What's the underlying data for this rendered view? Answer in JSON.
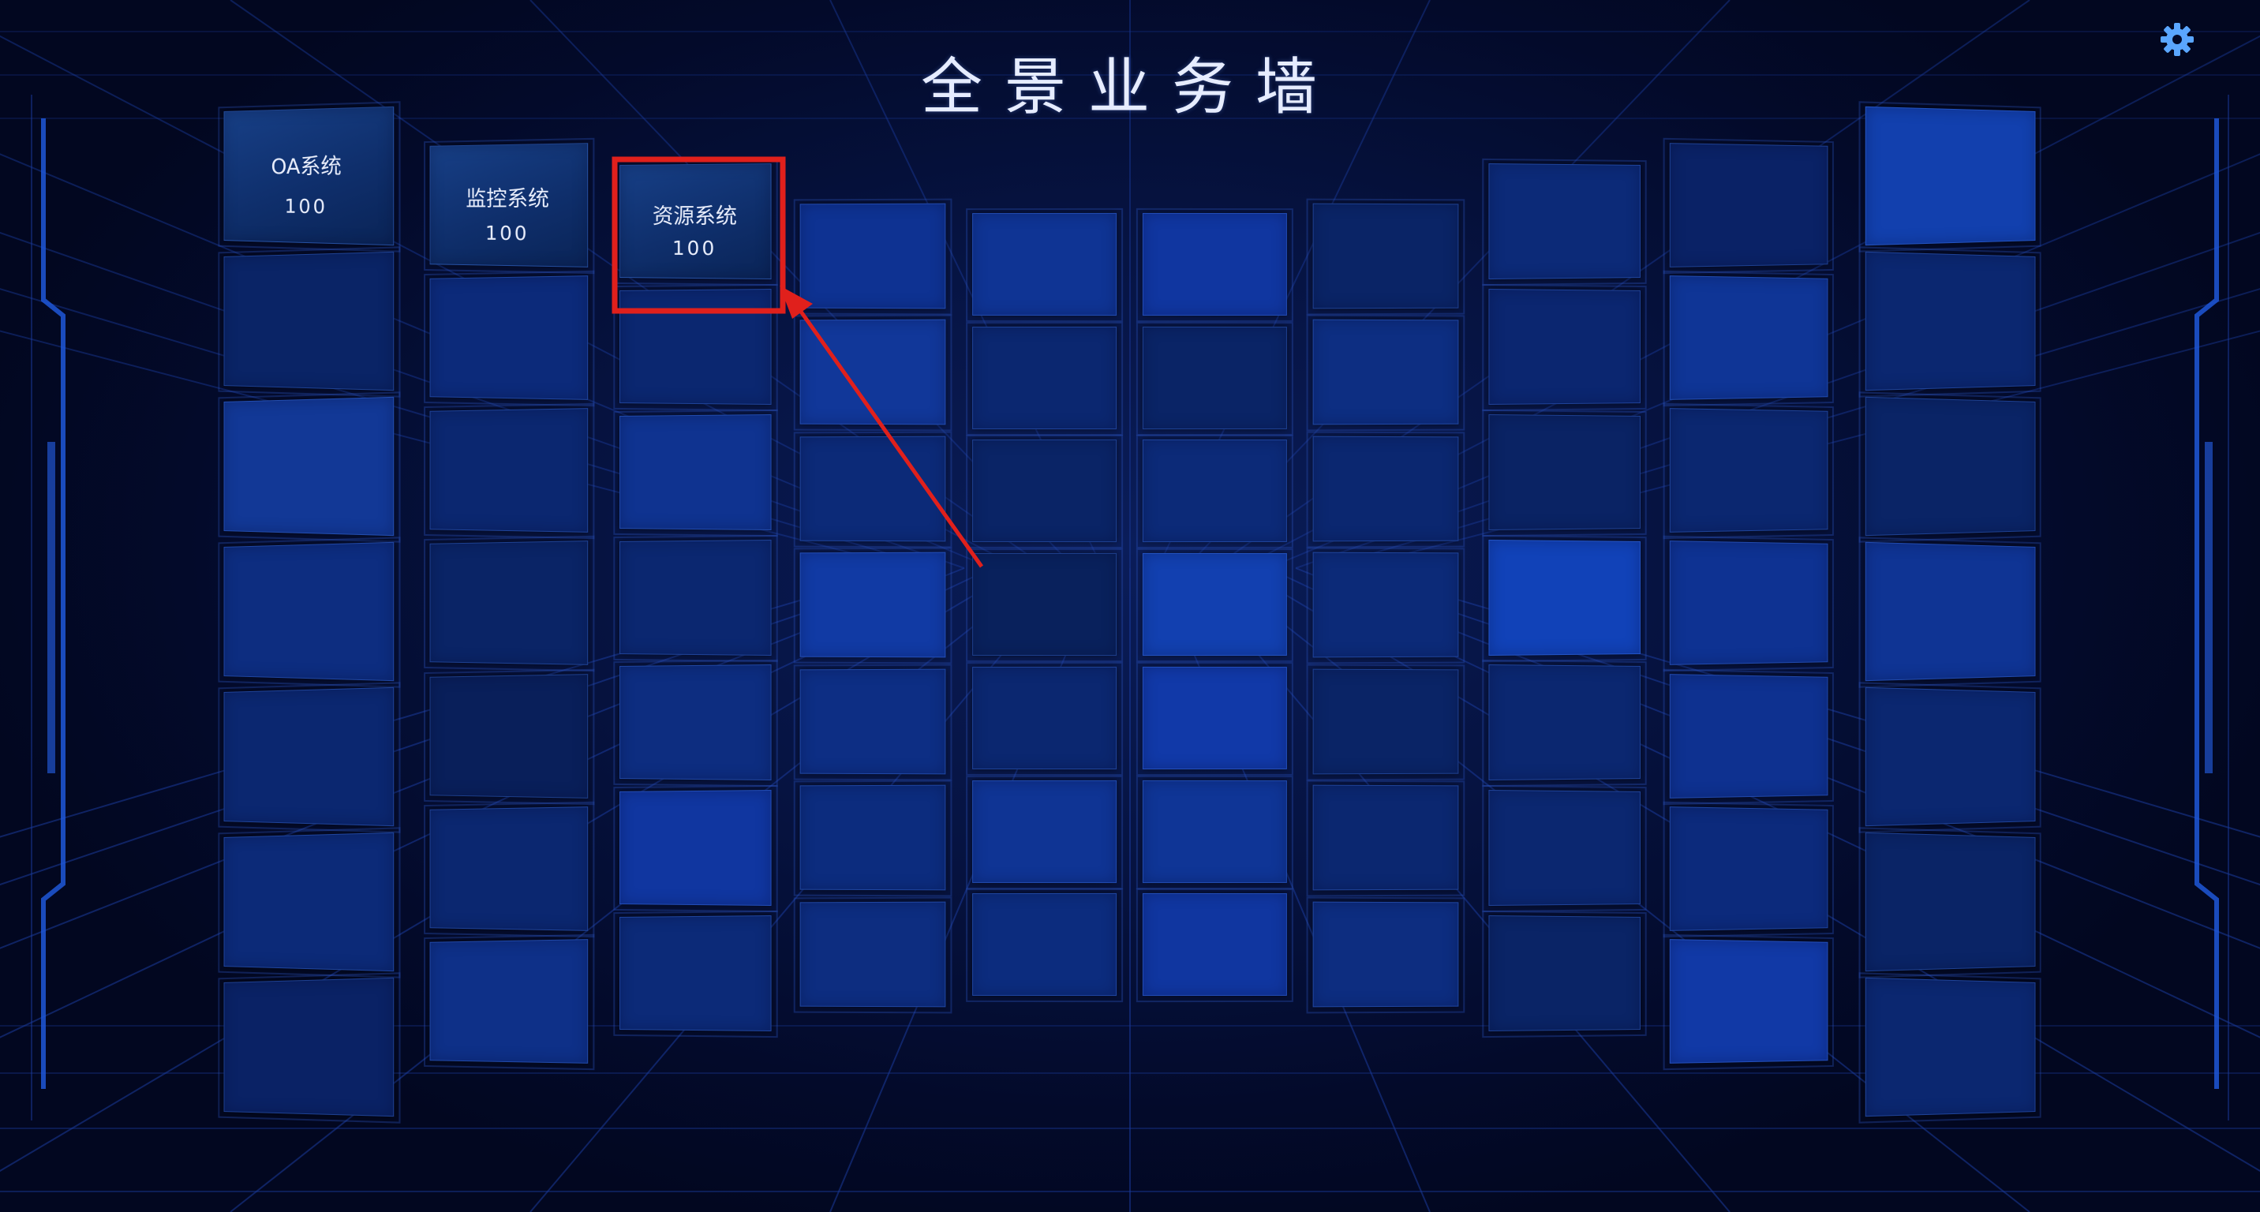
{
  "page": {
    "title": "全景业务墙",
    "settings_icon": "gear-icon",
    "accent_color": "#5aa6ff",
    "highlight_color": "#e0201c"
  },
  "wall": {
    "tiles": [
      {
        "name": "OA系统",
        "value": "100",
        "col": 0,
        "row": 0
      },
      {
        "name": "监控系统",
        "value": "100",
        "col": 1,
        "row": 0
      },
      {
        "name": "资源系统",
        "value": "100",
        "col": 2,
        "row": 0,
        "highlighted": true
      }
    ],
    "annotation": "red-box-and-arrow-pointing-to-tile"
  }
}
